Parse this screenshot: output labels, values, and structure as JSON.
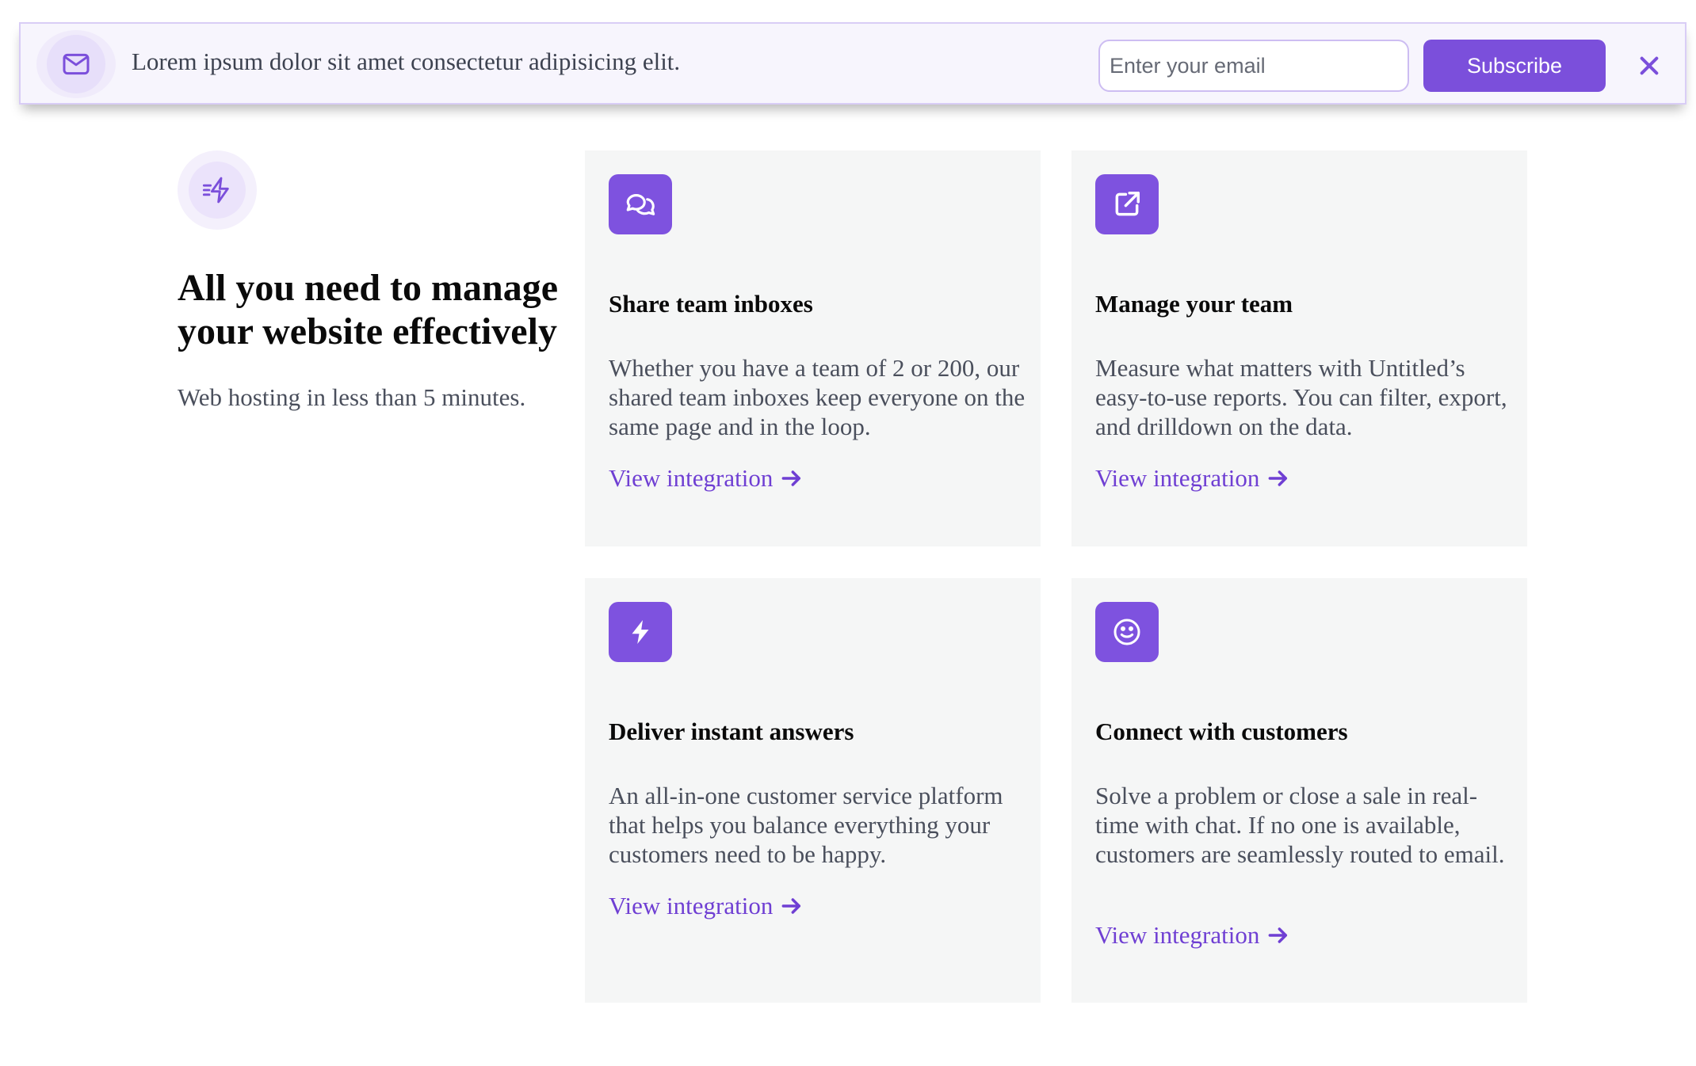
{
  "banner": {
    "icon": "mail-icon",
    "message": "Lorem ipsum dolor sit amet consectetur adipisicing elit.",
    "email_placeholder": "Enter your email",
    "subscribe_label": "Subscribe",
    "close_icon": "close-icon"
  },
  "intro": {
    "icon": "zap-fast-icon",
    "title": "All you need to manage your website effectively",
    "subtitle": "Web hosting in less than 5 minutes."
  },
  "cards": [
    {
      "icon": "message-chat-icon",
      "title": "Share team inboxes",
      "body": "Whether you have a team of 2 or 200, our shared team inboxes keep everyone on the same page and in the loop.",
      "link": "View integration"
    },
    {
      "icon": "external-link-icon",
      "title": "Manage your team",
      "body": "Measure what matters with Untitled’s easy-to-use reports. You can filter, export, and drilldown on the data.",
      "link": "View integration"
    },
    {
      "icon": "lightning-bolt-icon",
      "title": "Deliver instant answers",
      "body": "An all-in-one customer service platform that helps you balance everything your customers need to be happy.",
      "link": "View integration"
    },
    {
      "icon": "smile-icon",
      "title": "Connect with customers",
      "body": "Solve a problem or close a sale in real-time with chat. If no one is available, customers are seamlessly routed to email.",
      "link": "View integration"
    }
  ],
  "colors": {
    "accent": "#7b4fdb",
    "link": "#6f3fd3",
    "card_bg": "#f5f6f6",
    "banner_bg": "#f7f5fd"
  }
}
